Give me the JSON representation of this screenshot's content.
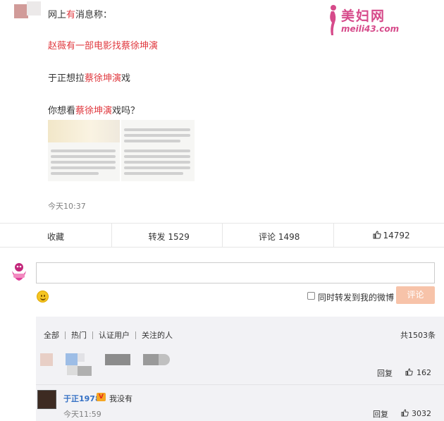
{
  "watermark": {
    "brand": "美妇网",
    "url": "meili43.com"
  },
  "post": {
    "line1": {
      "a": "网上",
      "b": "有",
      "c": "消息称："
    },
    "line2": "赵薇有一部电影找蔡徐坤演",
    "line3": {
      "a": "于正想拉",
      "b": "蔡徐坤演",
      "c": "戏"
    },
    "line4": {
      "a": "你想看",
      "b": "蔡徐坤演",
      "c": "戏吗？"
    },
    "time": "今天10:37"
  },
  "actions": {
    "favorite": "收藏",
    "repost": "转发 1529",
    "comment": "评论 1498",
    "like": "14792"
  },
  "composer": {
    "placeholder": "",
    "repost_option": "同时转发到我的微博",
    "submit": "评论"
  },
  "comments": {
    "filters": [
      "全部",
      "热门",
      "认证用户",
      "关注的人"
    ],
    "total": "共1503条",
    "items": [
      {
        "reply": "回复",
        "likes": "162"
      },
      {
        "user": "于正1978",
        "text": "我没有",
        "time": "今天11:59",
        "reply": "回复",
        "likes": "3032"
      }
    ]
  },
  "colors": {
    "accent": "#e0383e",
    "link": "#3470c4",
    "button": "#f7c3a9"
  }
}
